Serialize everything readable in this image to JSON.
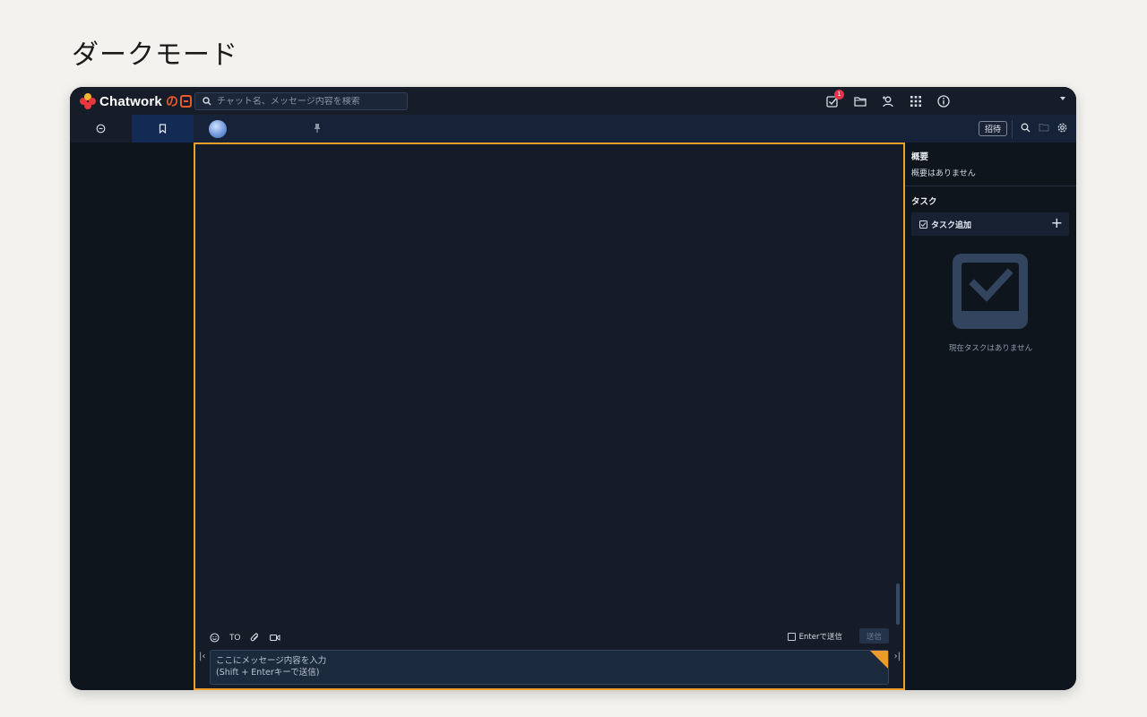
{
  "page_heading": "ダークモード",
  "app": {
    "logo_text": "Chatwork",
    "logo_suffix": "の",
    "search_placeholder": "チャット名、メッセージ内容を検索",
    "task_badge_count": "1"
  },
  "left_nav": {
    "tabs": [
      {
        "icon": "chat-bubble-icon",
        "active": false
      },
      {
        "icon": "bookmark-icon",
        "active": true
      }
    ]
  },
  "room_header": {
    "invite_label": "招待"
  },
  "composer": {
    "to_label": "TO",
    "enter_send_label": "Enterで送信",
    "send_label": "送信",
    "placeholder": "ここにメッセージ内容を入力\n(Shift + Enterキーで送信)"
  },
  "right_panel": {
    "summary_heading": "概要",
    "summary_text": "概要はありません",
    "tasks_heading": "タスク",
    "task_add_label": "タスク追加",
    "empty_tasks_text": "現在タスクはありません"
  },
  "colors": {
    "accent_orange": "#f0a02a",
    "brand_red": "#ea5a2a",
    "badge_red": "#e5344b",
    "active_tab": "#132a55"
  }
}
